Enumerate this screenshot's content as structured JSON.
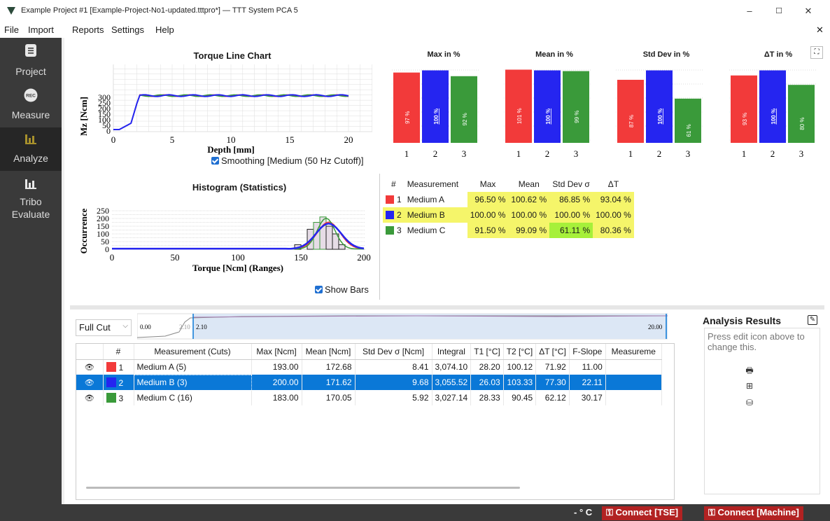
{
  "window": {
    "title": "Example Project #1 [Example-Project-No1-updated.tttpro*] — TTT System PCA 5",
    "min": "–",
    "max": "☐",
    "close": "✕",
    "menu_close": "✕"
  },
  "menu": [
    "File",
    "Import",
    "Reports",
    "Settings",
    "Help"
  ],
  "sidebar": [
    {
      "label": "Project",
      "icon": "document-icon"
    },
    {
      "label": "Measure",
      "icon": "rec-icon",
      "badge": "REC"
    },
    {
      "label": "Analyze",
      "icon": "bar-chart-icon"
    },
    {
      "label": "Tribo\nEvaluate",
      "label1": "Tribo",
      "label2": "Evaluate",
      "icon": "bar-chart-icon"
    }
  ],
  "torque_chart": {
    "title": "Torque Line Chart",
    "xlabel": "Depth [mm]",
    "ylabel": "Mz [Ncm]",
    "xticks": [
      "0",
      "5",
      "10",
      "15",
      "20"
    ],
    "yticks": [
      "0",
      "50",
      "100",
      "150",
      "200",
      "250",
      "300"
    ],
    "smoothing_label": "Smoothing [Medium (50 Hz Cutoff)]"
  },
  "histogram": {
    "title": "Histogram (Statistics)",
    "xlabel": "Torque [Ncm] (Ranges)",
    "ylabel": "Occurrence",
    "xticks": [
      "0",
      "50",
      "100",
      "150",
      "200"
    ],
    "yticks": [
      "0",
      "50",
      "100",
      "150",
      "200",
      "250"
    ],
    "show_bars_label": "Show Bars"
  },
  "bar_charts": [
    {
      "title": "Max in %",
      "labels": [
        "97 %",
        "100 %",
        "92 %"
      ]
    },
    {
      "title": "Mean in %",
      "labels": [
        "101 %",
        "100 %",
        "99 %"
      ]
    },
    {
      "title": "Std Dev in %",
      "labels": [
        "87 %",
        "100 %",
        "61 %"
      ]
    },
    {
      "title": "ΔT in %",
      "labels": [
        "93 %",
        "100 %",
        "80 %"
      ]
    }
  ],
  "bar_categories": [
    "1",
    "2",
    "3"
  ],
  "colors": {
    "red": "#f23a3a",
    "blue": "#2525f0",
    "green": "#3a9a3a",
    "yellow": "#f5f56a",
    "lime": "#a6f03a",
    "selected": "#0a78d7"
  },
  "stats_table": {
    "headers": [
      "#",
      "Measurement",
      "Max",
      "Mean",
      "Std Dev σ",
      "ΔT"
    ],
    "rows": [
      {
        "num": "1",
        "name": "Medium A",
        "max": "96.50 %",
        "mean": "100.62 %",
        "std": "86.85 %",
        "dt": "93.04 %"
      },
      {
        "num": "2",
        "name": "Medium B",
        "max": "100.00 %",
        "mean": "100.00 %",
        "std": "100.00 %",
        "dt": "100.00 %"
      },
      {
        "num": "3",
        "name": "Medium C",
        "max": "91.50 %",
        "mean": "99.09 %",
        "std": "61.11 %",
        "dt": "80.36 %"
      }
    ]
  },
  "cut_selector": {
    "value": "Full Cut",
    "range_start": "0.00",
    "range_left": "2.10",
    "range_sel": "2.10",
    "range_end": "20.00"
  },
  "cuts_table": {
    "headers": [
      "#",
      "Measurement (Cuts)",
      "Max [Ncm]",
      "Mean [Ncm]",
      "Std Dev σ [Ncm]",
      "Integral",
      "T1 [°C]",
      "T2 [°C]",
      "ΔT [°C]",
      "F-Slope",
      "Measureme"
    ],
    "rows": [
      {
        "num": "1",
        "name": "Medium A (5)",
        "max": "193.00",
        "mean": "172.68",
        "std": "8.41",
        "integral": "3,074.10",
        "t1": "28.20",
        "t2": "100.12",
        "dt": "71.92",
        "fslope": "11.00"
      },
      {
        "num": "2",
        "name": "Medium B (3)",
        "max": "200.00",
        "mean": "171.62",
        "std": "9.68",
        "integral": "3,055.52",
        "t1": "26.03",
        "t2": "103.33",
        "dt": "77.30",
        "fslope": "22.11"
      },
      {
        "num": "3",
        "name": "Medium C (16)",
        "max": "183.00",
        "mean": "170.05",
        "std": "5.92",
        "integral": "3,027.14",
        "t1": "28.33",
        "t2": "90.45",
        "dt": "62.12",
        "fslope": "30.17"
      }
    ]
  },
  "analysis": {
    "title": "Analysis Results",
    "placeholder": "Press edit icon above to change this."
  },
  "status": {
    "temp": "- ° C",
    "connect_tse": "Connect [TSE]",
    "connect_machine": "Connect [Machine]"
  }
}
